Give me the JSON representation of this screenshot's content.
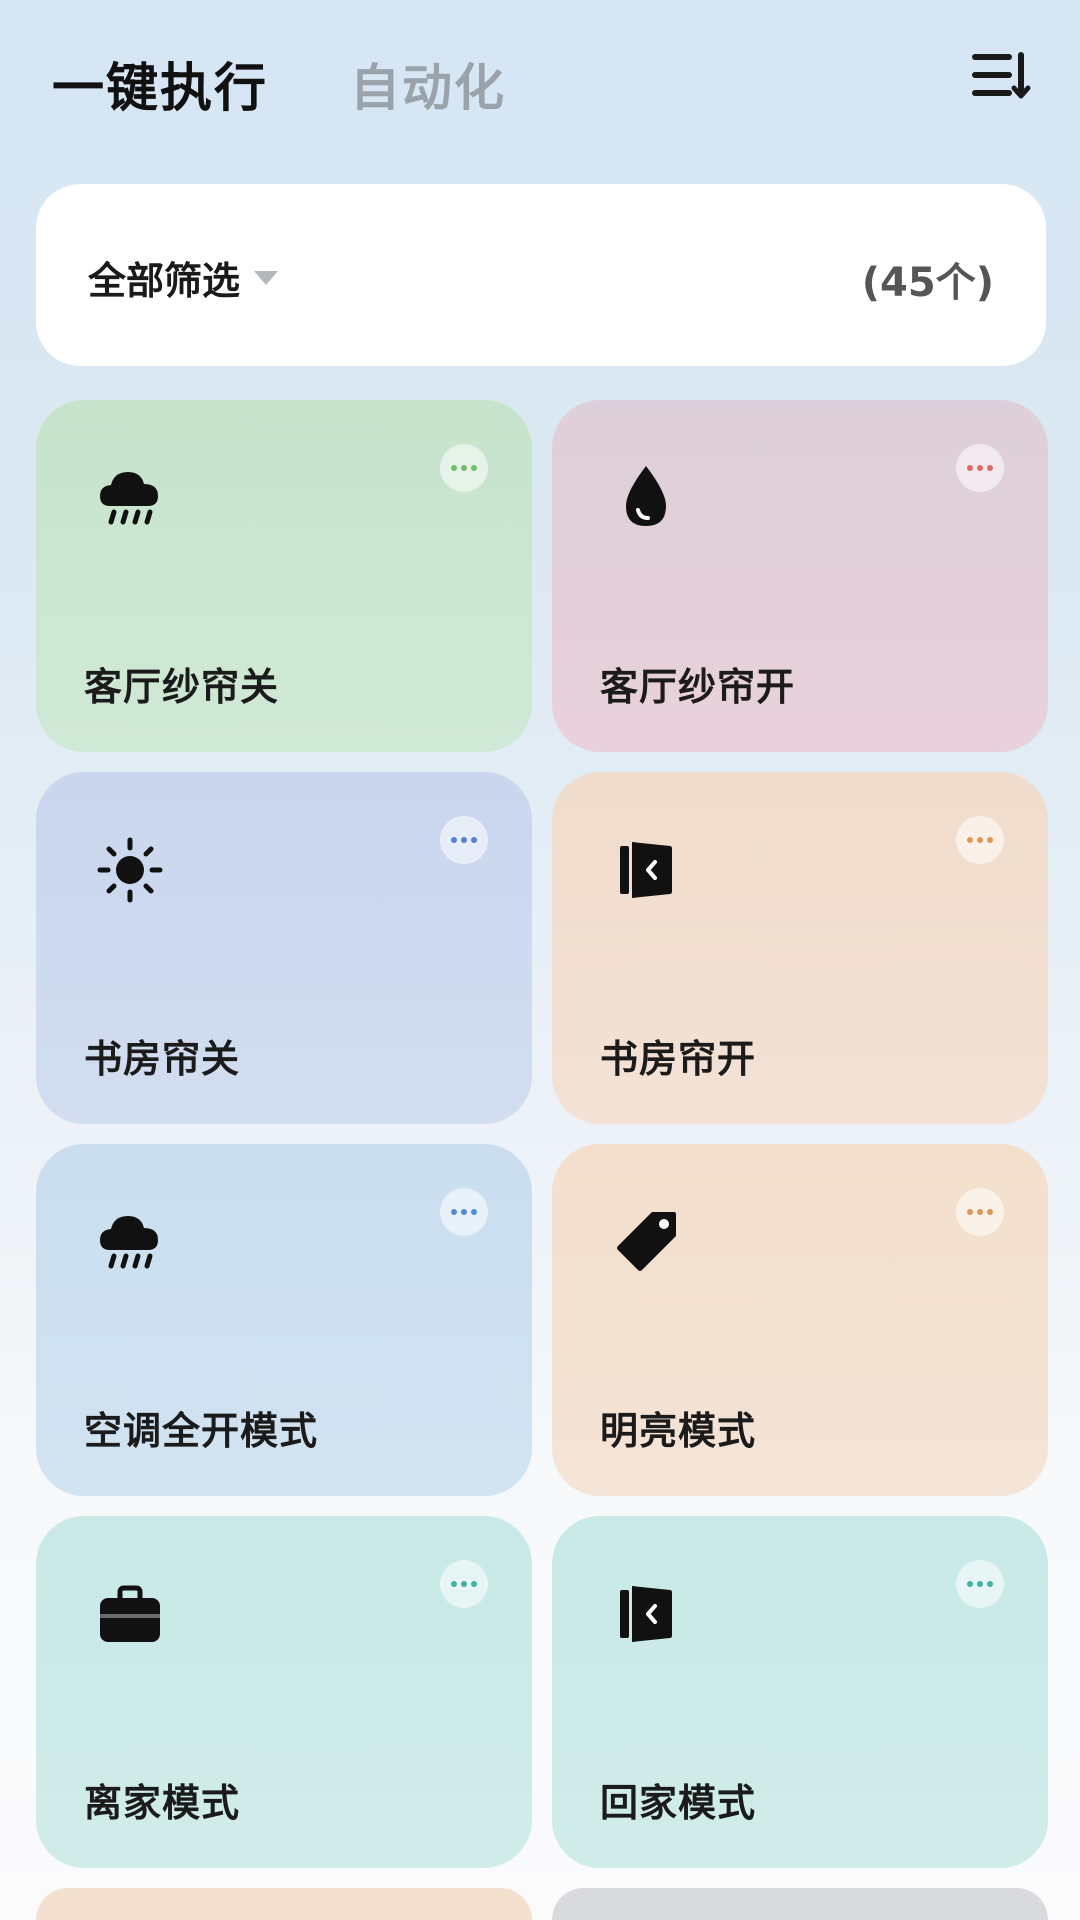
{
  "header": {
    "tab_active": "一键执行",
    "tab_inactive": "自动化",
    "menu_icon": "sort-list-icon"
  },
  "filter": {
    "label": "全部筛选",
    "count": "(45个)"
  },
  "cards": [
    {
      "label": "客厅纱帘关",
      "icon": "rain-cloud-icon",
      "bg_top": "#c7e3cc",
      "bg_bottom": "#d0e9d6",
      "dot_color": "#6fbf68"
    },
    {
      "label": "客厅纱帘开",
      "icon": "water-drop-icon",
      "bg_top": "#ddcfd9",
      "bg_bottom": "#e9d1db",
      "dot_color": "#e06a6a"
    },
    {
      "label": "书房帘关",
      "icon": "sun-icon",
      "bg_top": "#c9d6ee",
      "bg_bottom": "#d2ddf0",
      "dot_color": "#5a7fd3"
    },
    {
      "label": "书房帘开",
      "icon": "door-exit-icon",
      "bg_top": "#f0dccc",
      "bg_bottom": "#f3e2d5",
      "dot_color": "#e09550"
    },
    {
      "label": "空调全开模式",
      "icon": "rain-cloud-icon",
      "bg_top": "#cadef0",
      "bg_bottom": "#d2e3f1",
      "dot_color": "#4f8ed6"
    },
    {
      "label": "明亮模式",
      "icon": "tag-icon",
      "bg_top": "#f3dfcc",
      "bg_bottom": "#f4e4d7",
      "dot_color": "#e09550"
    },
    {
      "label": "离家模式",
      "icon": "briefcase-icon",
      "bg_top": "#c8e9e6",
      "bg_bottom": "#d0ece9",
      "dot_color": "#3fb0a6"
    },
    {
      "label": "回家模式",
      "icon": "door-exit-icon",
      "bg_top": "#c8e9e6",
      "bg_bottom": "#d0ece9",
      "dot_color": "#3fb0a6"
    }
  ],
  "peek_colors": [
    "#f3e0cf",
    "#d8dadd"
  ]
}
